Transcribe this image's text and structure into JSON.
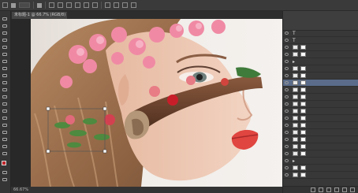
{
  "document_tab": {
    "label": "未标题-1 @ 66.7% (RGB/8)"
  },
  "status": {
    "zoom": "66.67%"
  },
  "layers": [
    {
      "label": "",
      "kind": "text"
    },
    {
      "label": "",
      "kind": "text"
    },
    {
      "label": "",
      "kind": "layer"
    },
    {
      "label": "",
      "kind": "layer"
    },
    {
      "label": "",
      "kind": "group"
    },
    {
      "label": "",
      "kind": "layer"
    },
    {
      "label": "",
      "kind": "layer"
    },
    {
      "label": "",
      "kind": "layer"
    },
    {
      "label": "",
      "kind": "layer"
    },
    {
      "label": "",
      "kind": "layer"
    },
    {
      "label": "",
      "kind": "layer"
    },
    {
      "label": "",
      "kind": "layer"
    },
    {
      "label": "",
      "kind": "layer"
    },
    {
      "label": "",
      "kind": "layer"
    },
    {
      "label": "",
      "kind": "layer"
    },
    {
      "label": "",
      "kind": "layer"
    },
    {
      "label": "",
      "kind": "layer"
    },
    {
      "label": "",
      "kind": "layer"
    },
    {
      "label": "",
      "kind": "group"
    },
    {
      "label": "",
      "kind": "layer"
    },
    {
      "label": "",
      "kind": "layer"
    }
  ],
  "selected_layer_index": 7,
  "colors": {
    "accent": "#5a6c8a",
    "bg": "#3c3c3c"
  }
}
